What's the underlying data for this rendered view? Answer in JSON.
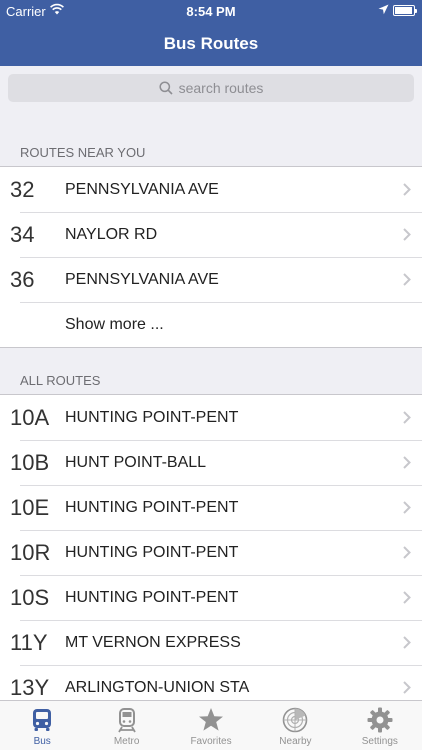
{
  "status": {
    "carrier": "Carrier",
    "time": "8:54 PM"
  },
  "nav": {
    "title": "Bus Routes"
  },
  "search": {
    "placeholder": "search routes"
  },
  "sections": {
    "nearby_header": "ROUTES NEAR YOU",
    "all_header": "ALL ROUTES"
  },
  "nearby_routes": [
    {
      "number": "32",
      "name": "PENNSYLVANIA AVE"
    },
    {
      "number": "34",
      "name": "NAYLOR RD"
    },
    {
      "number": "36",
      "name": "PENNSYLVANIA AVE"
    }
  ],
  "show_more": "Show more ...",
  "all_routes": [
    {
      "number": "10A",
      "name": "HUNTING POINT-PENT"
    },
    {
      "number": "10B",
      "name": "HUNT POINT-BALL"
    },
    {
      "number": "10E",
      "name": "HUNTING POINT-PENT"
    },
    {
      "number": "10R",
      "name": "HUNTING POINT-PENT"
    },
    {
      "number": "10S",
      "name": "HUNTING POINT-PENT"
    },
    {
      "number": "11Y",
      "name": "MT VERNON EXPRESS"
    },
    {
      "number": "13Y",
      "name": "ARLINGTON-UNION STA"
    }
  ],
  "tabs": [
    {
      "label": "Bus",
      "icon": "bus-icon",
      "active": true
    },
    {
      "label": "Metro",
      "icon": "metro-icon",
      "active": false
    },
    {
      "label": "Favorites",
      "icon": "star-icon",
      "active": false
    },
    {
      "label": "Nearby",
      "icon": "radar-icon",
      "active": false
    },
    {
      "label": "Settings",
      "icon": "gear-icon",
      "active": false
    }
  ],
  "colors": {
    "nav_bar": "#3f5fa3",
    "tab_active": "#3f5fa3",
    "tab_inactive": "#929292"
  }
}
